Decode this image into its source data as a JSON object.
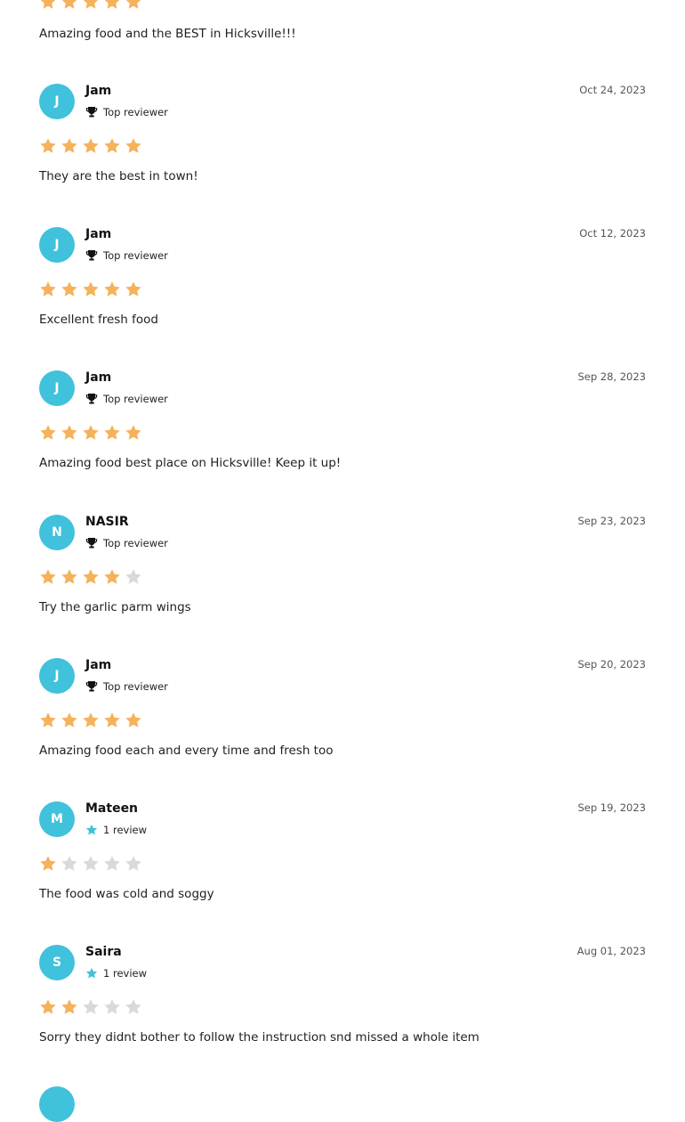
{
  "colors": {
    "avatar": "#40c1dc",
    "star_filled": "#f5b25b",
    "star_empty": "#d9d9d9"
  },
  "top_review": {
    "rating": 5,
    "text": "Amazing food and the BEST in Hicksville!!!"
  },
  "reviews": [
    {
      "initial": "J",
      "name": "Jam",
      "badge_icon": "trophy-icon",
      "badge": "Top reviewer",
      "date": "Oct 24, 2023",
      "rating": 5,
      "text": "They are the best in town!"
    },
    {
      "initial": "J",
      "name": "Jam",
      "badge_icon": "trophy-icon",
      "badge": "Top reviewer",
      "date": "Oct 12, 2023",
      "rating": 5,
      "text": "Excellent fresh food"
    },
    {
      "initial": "J",
      "name": "Jam",
      "badge_icon": "trophy-icon",
      "badge": "Top reviewer",
      "date": "Sep 28, 2023",
      "rating": 5,
      "text": "Amazing food best place on Hicksville! Keep it up!"
    },
    {
      "initial": "N",
      "name": "NASIR",
      "badge_icon": "trophy-icon",
      "badge": "Top reviewer",
      "date": "Sep 23, 2023",
      "rating": 4,
      "text": "Try the garlic parm wings"
    },
    {
      "initial": "J",
      "name": "Jam",
      "badge_icon": "trophy-icon",
      "badge": "Top reviewer",
      "date": "Sep 20, 2023",
      "rating": 5,
      "text": "Amazing food each and every time and fresh too"
    },
    {
      "initial": "M",
      "name": "Mateen",
      "badge_icon": "star-icon",
      "badge": "1 review",
      "date": "Sep 19, 2023",
      "rating": 1,
      "text": "The food was cold and soggy"
    },
    {
      "initial": "S",
      "name": "Saira",
      "badge_icon": "star-icon",
      "badge": "1 review",
      "date": "Aug 01, 2023",
      "rating": 2,
      "text": "Sorry they didnt bother to follow the instruction snd missed a whole item"
    }
  ]
}
